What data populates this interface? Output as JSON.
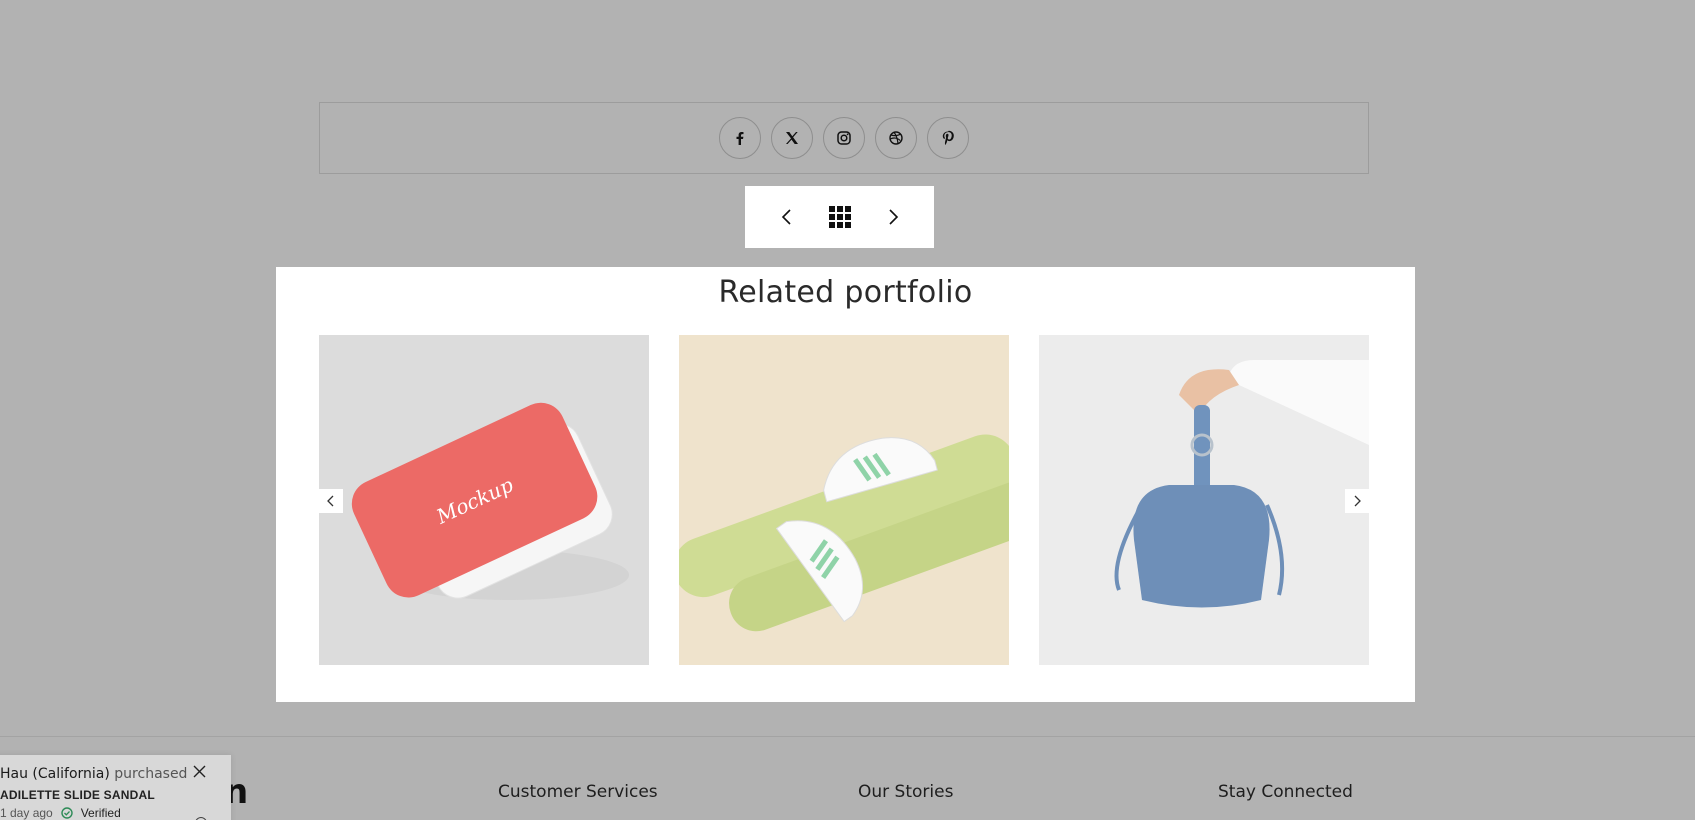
{
  "social": {
    "items": [
      {
        "name": "facebook"
      },
      {
        "name": "x"
      },
      {
        "name": "instagram"
      },
      {
        "name": "dribbble"
      },
      {
        "name": "pinterest"
      }
    ]
  },
  "pager": {
    "prev": "prev-icon",
    "grid": "grid-icon",
    "next": "next-icon"
  },
  "related": {
    "title": "Related portfolio"
  },
  "footer": {
    "logo_fragment": "n",
    "columns": [
      "Customer Services",
      "Our Stories",
      "Stay Connected"
    ]
  },
  "toast": {
    "buyer": "Hau (California)",
    "action": "purchased",
    "product": "ADILETTE SLIDE SANDAL",
    "time": "1 day ago",
    "verified": "Verified"
  }
}
